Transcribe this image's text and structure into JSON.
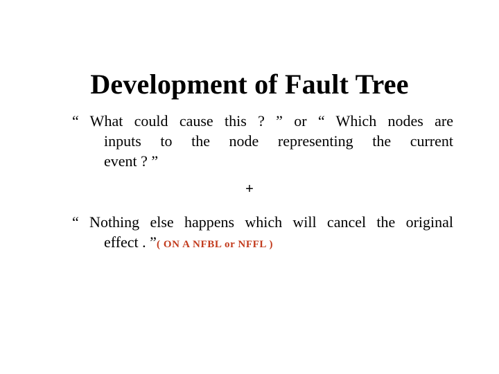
{
  "slide": {
    "title": "Development of Fault Tree",
    "background_color": "#FFFFFF",
    "text_color": "#000000",
    "accent_color": "#C23A1C"
  },
  "content": {
    "paragraph_1": {
      "full_text": "“ What could cause this ? ” or “ Which nodes are inputs to the node representing the current event ? ”",
      "lines": [
        "“ What  could  cause  this ? ”  or  “ Which  nodes  are",
        "inputs  to  the  node  representing  the   current",
        "event ? ”"
      ]
    },
    "operator": {
      "symbol": "+",
      "name": "plus-operator"
    },
    "paragraph_2": {
      "full_text": "“ Nothing else happens which will cancel the original effect . ”",
      "lines": [
        "“ Nothing  else  happens  which  will  cancel  the original",
        "effect . ”"
      ],
      "annotation": {
        "open_paren": "(",
        "close_paren": ")",
        "terms": [
          "ON",
          "A",
          "NFBL",
          "or",
          "NFFL"
        ],
        "full_text": "( ON  A  NFBL  or  NFFL )",
        "color": "#C23A1C"
      }
    }
  }
}
